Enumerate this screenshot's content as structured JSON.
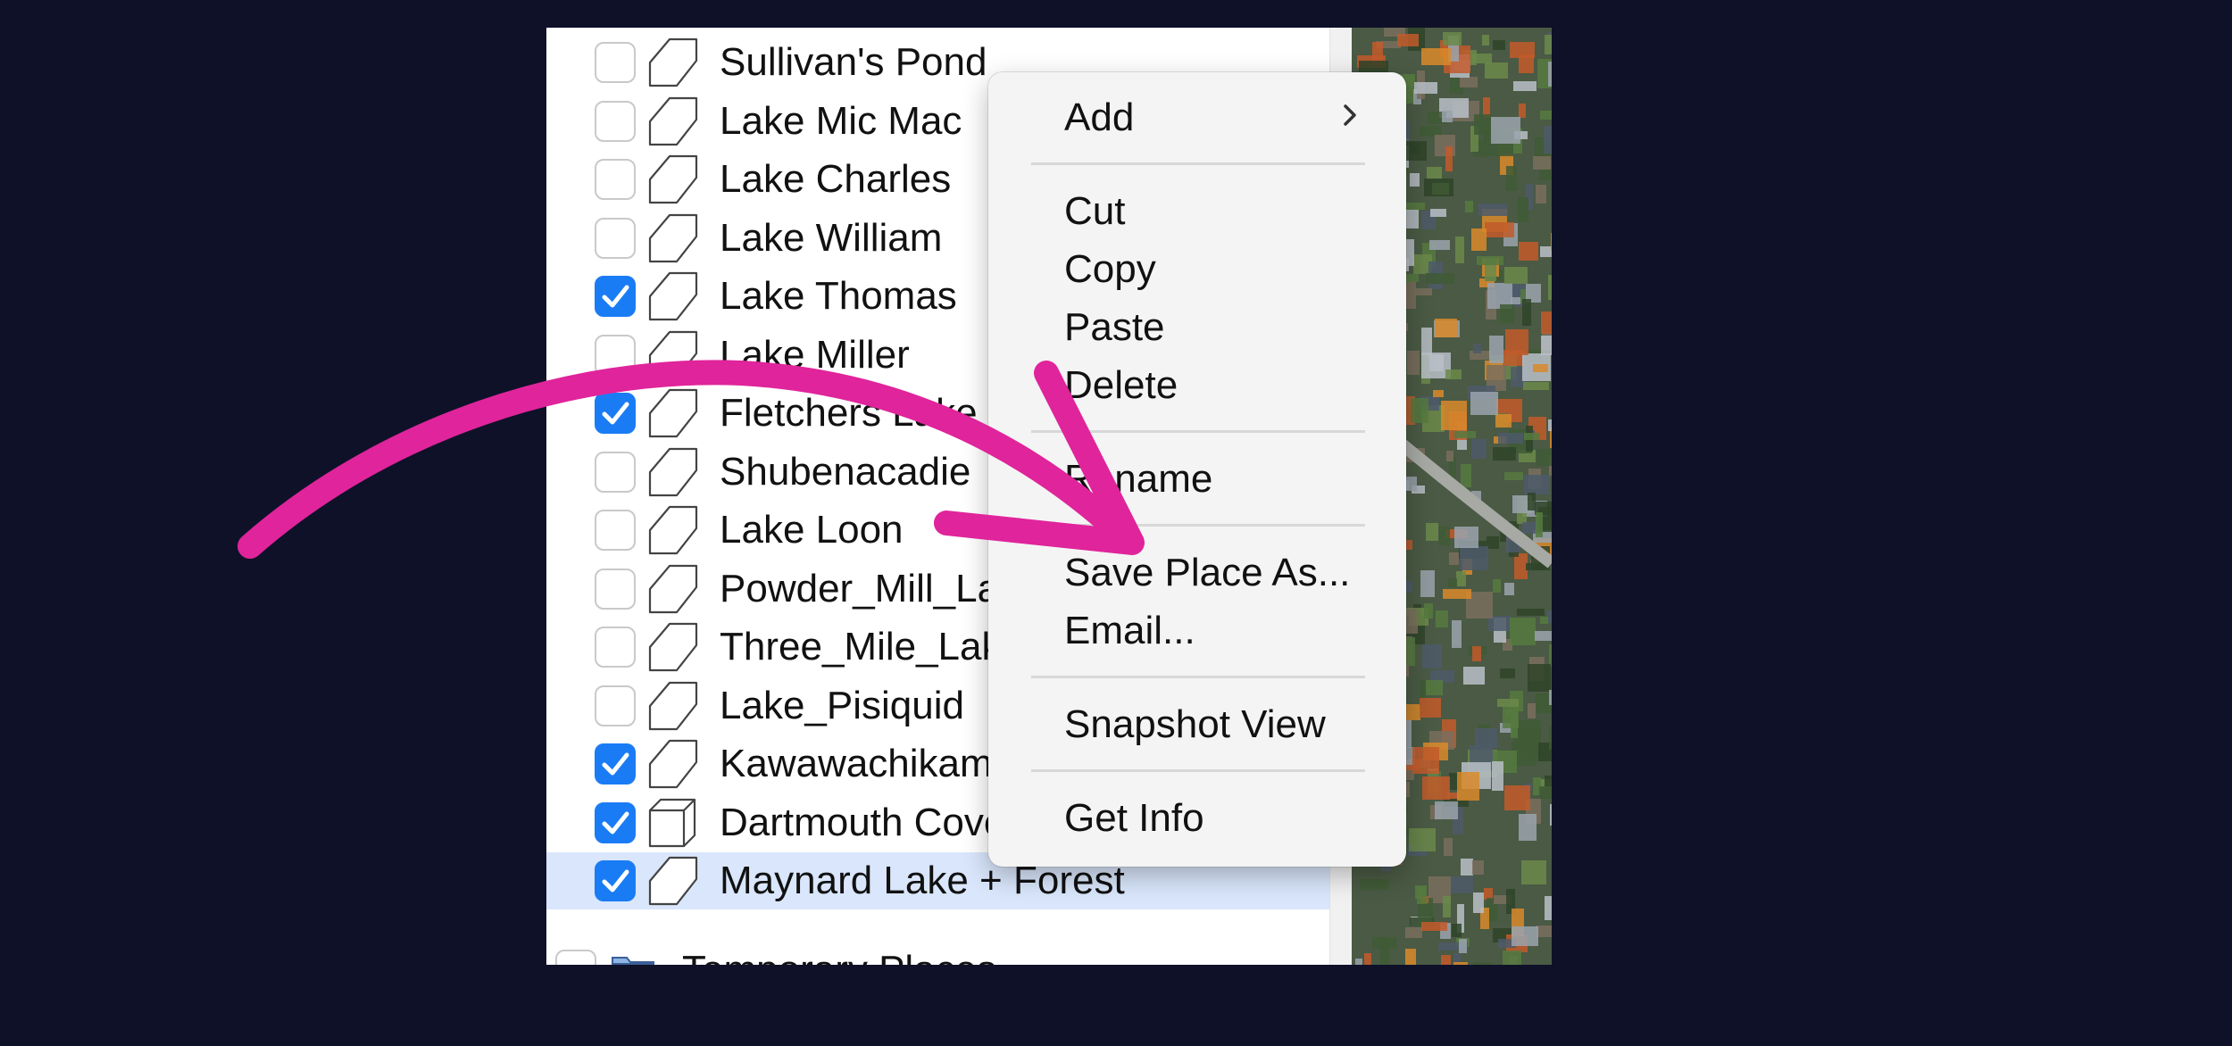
{
  "places_list": {
    "rows": [
      {
        "label": "Sullivan's Pond",
        "checked": false,
        "icon": "polygon-icon"
      },
      {
        "label": "Lake Mic Mac",
        "checked": false,
        "icon": "polygon-icon"
      },
      {
        "label": "Lake Charles",
        "checked": false,
        "icon": "polygon-icon"
      },
      {
        "label": "Lake William",
        "checked": false,
        "icon": "polygon-icon"
      },
      {
        "label": "Lake Thomas",
        "checked": true,
        "icon": "polygon-icon"
      },
      {
        "label": "Lake Miller",
        "checked": false,
        "icon": "polygon-icon"
      },
      {
        "label": "Fletchers Lake",
        "checked": true,
        "icon": "polygon-icon"
      },
      {
        "label": "Shubenacadie",
        "checked": false,
        "icon": "polygon-icon"
      },
      {
        "label": "Lake Loon",
        "checked": false,
        "icon": "polygon-icon"
      },
      {
        "label": "Powder_Mill_Lake",
        "checked": false,
        "icon": "polygon-icon"
      },
      {
        "label": "Three_Mile_Lake",
        "checked": false,
        "icon": "polygon-icon"
      },
      {
        "label": "Lake_Pisiquid",
        "checked": false,
        "icon": "polygon-icon"
      },
      {
        "label": "Kawawachikamach",
        "checked": true,
        "icon": "polygon-icon"
      },
      {
        "label": "Dartmouth Cove",
        "checked": true,
        "icon": "3d-model-icon"
      },
      {
        "label": "Maynard Lake + Forest",
        "checked": true,
        "icon": "polygon-icon",
        "selected": true
      }
    ],
    "temporary_places": {
      "label": "Temporary Places",
      "checked": false,
      "icon": "folder-icon"
    }
  },
  "context_menu": {
    "add": "Add",
    "cut": "Cut",
    "copy": "Copy",
    "paste": "Paste",
    "delete": "Delete",
    "rename": "Rename",
    "save_place_as": "Save Place As...",
    "email": "Email...",
    "snapshot_view": "Snapshot View",
    "get_info": "Get Info"
  },
  "colors": {
    "background": "#0f1129",
    "checkbox_checked": "#1a7cf5",
    "selected_row": "#d9e6fb",
    "annotation_arrow": "#e0249b"
  }
}
